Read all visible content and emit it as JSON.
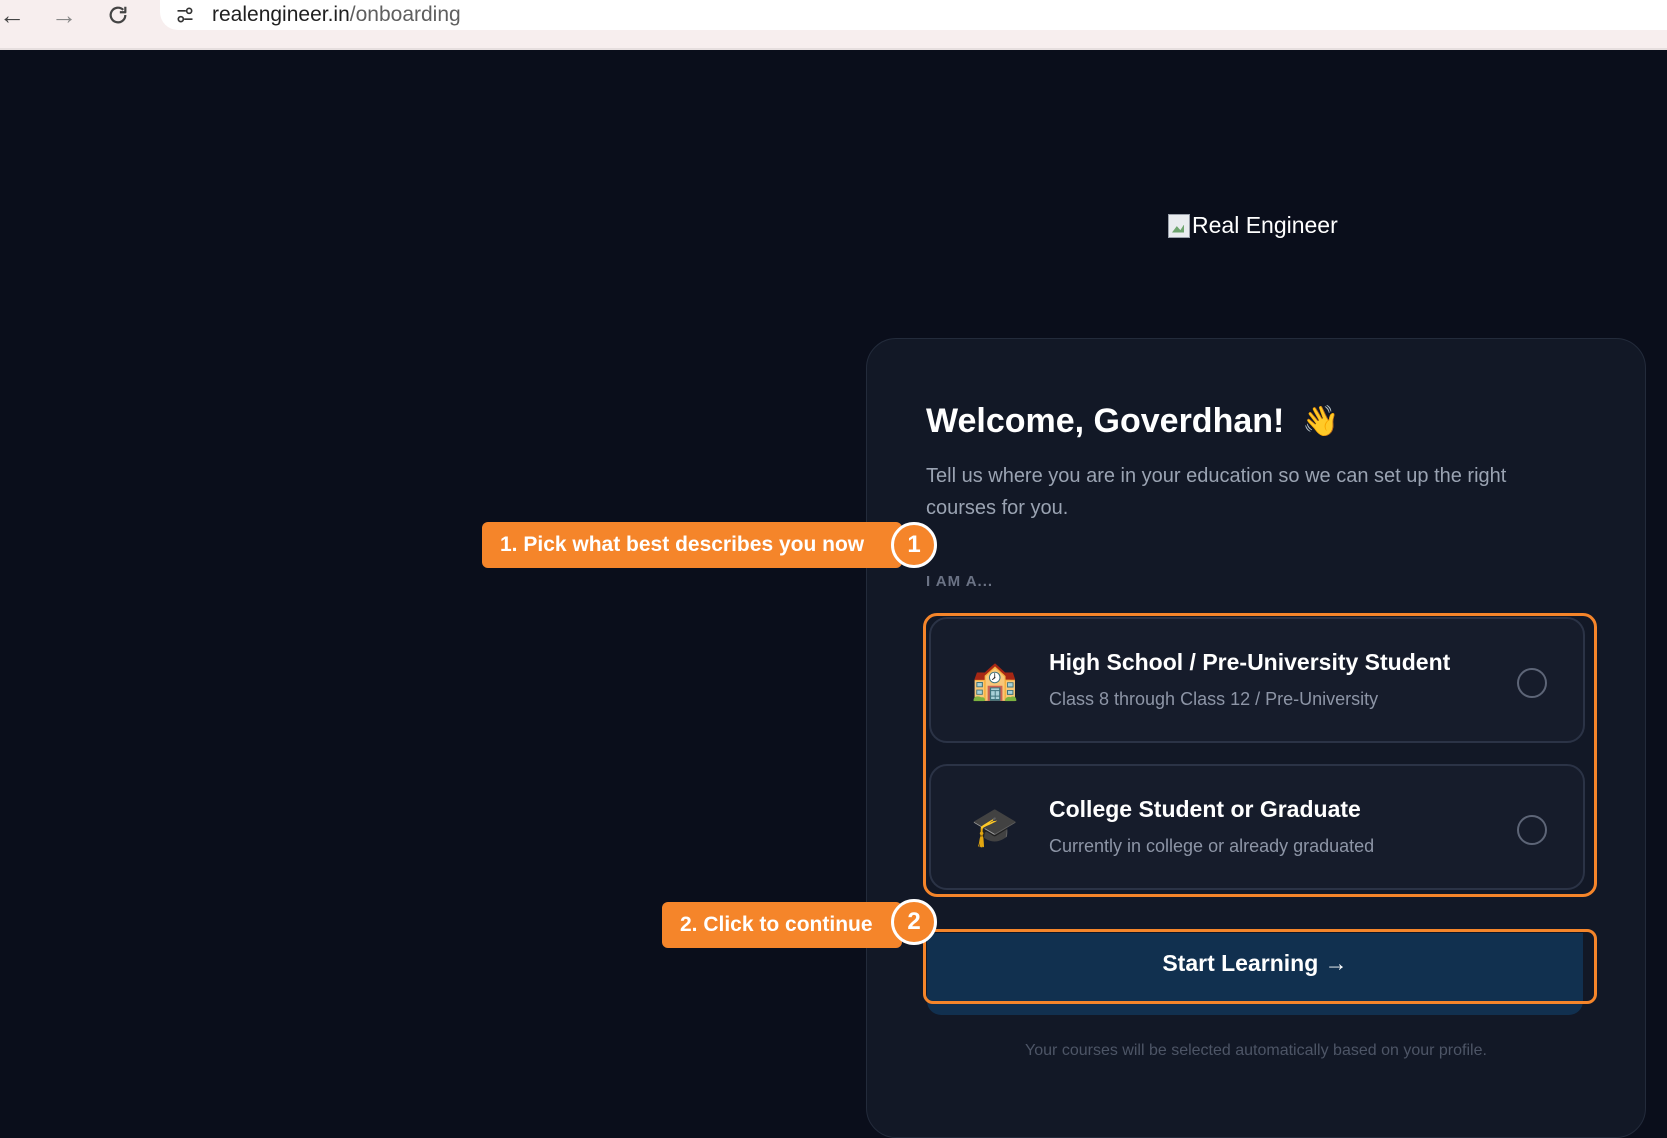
{
  "browser": {
    "url_host": "realengineer.in",
    "url_path": "/onboarding"
  },
  "logo": {
    "alt_text": "Real Engineer"
  },
  "card": {
    "welcome": "Welcome, Goverdhan!",
    "wave_emoji": "👋",
    "subtitle": "Tell us where you are in your education so we can set up the right courses for you.",
    "section_label": "I AM A...",
    "options": [
      {
        "icon": "🏫",
        "title": "High School / Pre-University Student",
        "description": "Class 8 through Class 12 / Pre-University"
      },
      {
        "icon": "🎓",
        "title": "College Student or Graduate",
        "description": "Currently in college or already graduated"
      }
    ],
    "start_button": "Start Learning →",
    "footnote": "Your courses will be selected automatically based on your profile."
  },
  "callouts": [
    {
      "text": "1. Pick what best describes you now",
      "number": "1"
    },
    {
      "text": "2. Click to continue",
      "number": "2"
    }
  ],
  "colors": {
    "background": "#0a0e1b",
    "card": "#121826",
    "accent_orange": "#f5852a",
    "button": "#11304f"
  }
}
